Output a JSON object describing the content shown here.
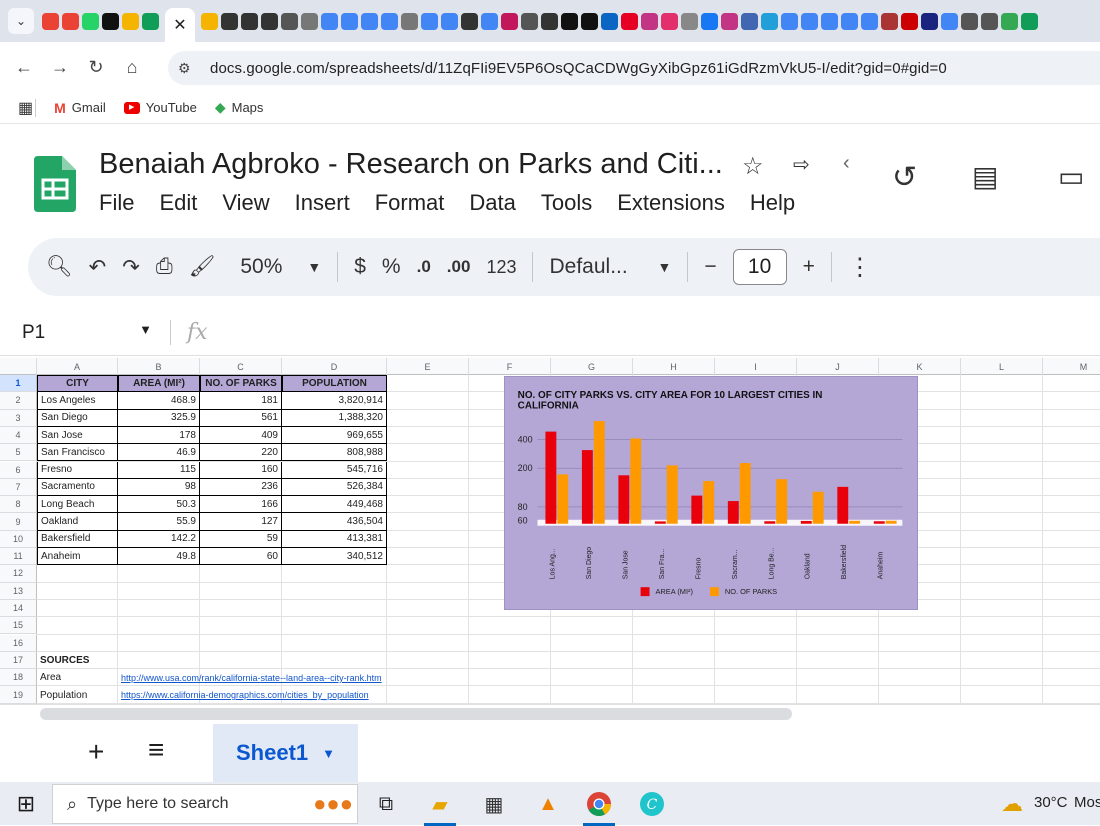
{
  "browser": {
    "active_tab_close": "✕",
    "address": "docs.google.com/spreadsheets/d/11ZqFIi9EV5P6OsQCaCDWgGyXibGpz61iGdRzmVkU5-I/edit?gid=0#gid=0",
    "bookmarks": [
      "Gmail",
      "YouTube",
      "Maps"
    ],
    "favicon_colors": [
      "#ea4335",
      "#ea4335",
      "#25d366",
      "#111",
      "#f4b400",
      "#0f9d58",
      "#f4b400",
      "#333",
      "#333",
      "#333",
      "#555",
      "#777",
      "#4285f4",
      "#4285f4",
      "#4285f4",
      "#4285f4",
      "#777",
      "#4285f4",
      "#4285f4",
      "#333",
      "#4285f4",
      "#c2185b",
      "#555",
      "#333",
      "#111",
      "#111",
      "#0a66c2",
      "#e60023",
      "#c13584",
      "#e1306c",
      "#888",
      "#1877f2",
      "#c13584",
      "#4267b2",
      "#229ed9",
      "#4285f4",
      "#4285f4",
      "#4285f4",
      "#4285f4",
      "#4285f4",
      "#a33",
      "#c00",
      "#1a237e",
      "#4285f4",
      "#555",
      "#555",
      "#34a853",
      "#0f9d58"
    ]
  },
  "doc": {
    "title": "Benaiah Agbroko - Research on Parks and Citi...",
    "menus": [
      "File",
      "Edit",
      "View",
      "Insert",
      "Format",
      "Data",
      "Tools",
      "Extensions",
      "Help"
    ]
  },
  "toolbar": {
    "zoom": "50%",
    "currency": "$",
    "percent": "%",
    "dec_decrease": ".0",
    "dec_increase": ".00",
    "number_format": "123",
    "font": "Defaul...",
    "font_size": "10"
  },
  "formula_bar": {
    "cell_ref": "P1",
    "fx": "fx"
  },
  "grid": {
    "columns": [
      "A",
      "B",
      "C",
      "D",
      "E",
      "F",
      "G",
      "H",
      "I",
      "J",
      "K",
      "L",
      "M"
    ],
    "rows": [
      "1",
      "2",
      "3",
      "4",
      "5",
      "6",
      "7",
      "8",
      "9",
      "10",
      "11",
      "12",
      "13",
      "14",
      "15",
      "16",
      "17",
      "18",
      "19"
    ],
    "header": [
      "CITY",
      "AREA (MI²)",
      "NO. OF PARKS",
      "POPULATION"
    ],
    "data": [
      [
        "Los Angeles",
        "468.9",
        "181",
        "3,820,914"
      ],
      [
        "San Diego",
        "325.9",
        "561",
        "1,388,320"
      ],
      [
        "San Jose",
        "178",
        "409",
        "969,655"
      ],
      [
        "San Francisco",
        "46.9",
        "220",
        "808,988"
      ],
      [
        "Fresno",
        "115",
        "160",
        "545,716"
      ],
      [
        "Sacramento",
        "98",
        "236",
        "526,384"
      ],
      [
        "Long Beach",
        "50.3",
        "166",
        "449,468"
      ],
      [
        "Oakland",
        "55.9",
        "127",
        "436,504"
      ],
      [
        "Bakersfield",
        "142.2",
        "59",
        "413,381"
      ],
      [
        "Anaheim",
        "49.8",
        "60",
        "340,512"
      ]
    ],
    "sources_label": "SOURCES",
    "sources": [
      {
        "label": "Area",
        "url": "http://www.usa.com/rank/california-state--land-area--city-rank.htm"
      },
      {
        "label": "Population",
        "url": "https://www.california-demographics.com/cities_by_population"
      }
    ]
  },
  "chart_data": {
    "type": "bar",
    "title": "NO. OF CITY PARKS VS. CITY AREA FOR 10 LARGEST CITIES IN CALIFORNIA",
    "categories": [
      "Los Ang...",
      "San Diego",
      "San Jose",
      "San Fra...",
      "Fresno",
      "Sacram...",
      "Long Be...",
      "Oakland",
      "Bakersfield",
      "Anaheim"
    ],
    "series": [
      {
        "name": "AREA (MI²)",
        "color": "#e8000b",
        "values": [
          468.9,
          325.9,
          178,
          46.9,
          115,
          98,
          50.3,
          55.9,
          142.2,
          49.8
        ]
      },
      {
        "name": "NO. OF PARKS",
        "color": "#ff9900",
        "values": [
          181,
          561,
          409,
          220,
          160,
          236,
          166,
          127,
          59,
          60
        ]
      }
    ],
    "y_ticks": [
      "400",
      "200",
      "80",
      "60"
    ],
    "legend": "bottom",
    "grid": true
  },
  "sheet_tabs": {
    "add": "+",
    "menu": "≡",
    "active": "Sheet1"
  },
  "taskbar": {
    "search_placeholder": "Type here to search",
    "temperature": "30°C",
    "weather": "Mos"
  }
}
